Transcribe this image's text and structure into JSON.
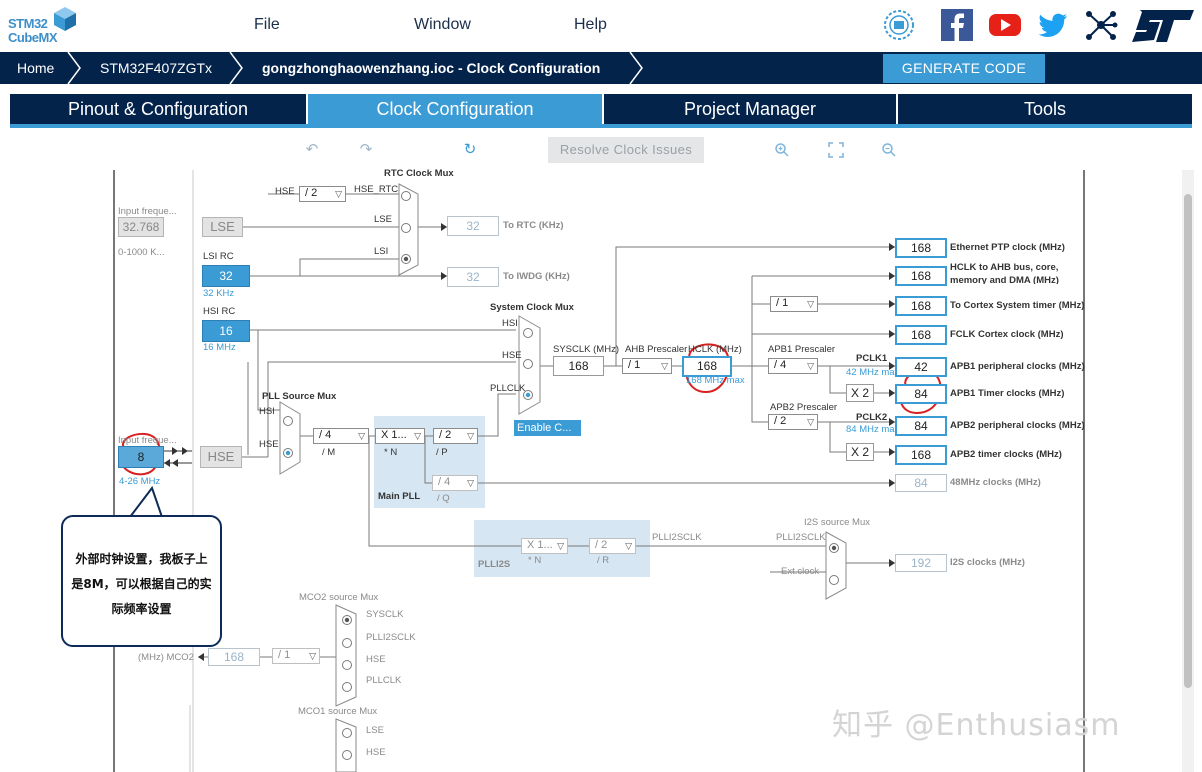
{
  "app": {
    "logo_line1": "STM32",
    "logo_line2": "CubeMX"
  },
  "menu": {
    "file": "File",
    "window": "Window",
    "help": "Help"
  },
  "social_icons": [
    "anniversary-badge-icon",
    "facebook-icon",
    "youtube-icon",
    "twitter-icon",
    "network-share-icon",
    "st-logo-icon"
  ],
  "breadcrumb": {
    "home": "Home",
    "device": "STM32F407ZGTx",
    "project": "gongzhonghaowenzhang.ioc - Clock Configuration"
  },
  "generate_label": "GENERATE CODE",
  "tabs": [
    "Pinout & Configuration",
    "Clock Configuration",
    "Project Manager",
    "Tools"
  ],
  "toolbar": {
    "resolve_label": "Resolve Clock Issues"
  },
  "colors": {
    "navy": "#03234b",
    "accent": "#3a9bd5",
    "annotation_red": "#d92020"
  },
  "diagram": {
    "lse_input_label": "Input freque...",
    "lse_input_value": "32.768",
    "lse_range": "0-1000 K...",
    "lse_label": "LSE",
    "lsi_rc_label": "LSI RC",
    "lsi_value": "32",
    "lsi_khz": "32 KHz",
    "hsi_rc_label": "HSI RC",
    "hsi_value": "16",
    "hsi_mhz": "16 MHz",
    "hse_input_label": "Input freque...",
    "hse_input_value": "8",
    "hse_range": "4-26 MHz",
    "hse_label": "HSE",
    "rtc_mux_title": "RTC Clock Mux",
    "rtc_mux_in_hse": "HSE",
    "rtc_div": "/ 2",
    "rtc_hse_rtc": "HSE_RTC",
    "rtc_lse": "LSE",
    "rtc_lsi": "LSI",
    "rtc_out_value": "32",
    "rtc_out_label": "To RTC (KHz)",
    "iwdg_out_value": "32",
    "iwdg_out_label": "To IWDG (KHz)",
    "sys_mux_title": "System Clock Mux",
    "sys_hsi": "HSI",
    "sys_hse": "HSE",
    "sys_pllclk": "PLLCLK",
    "enable_css": "Enable C...",
    "pll_src_title": "PLL Source Mux",
    "pll_src_hsi": "HSI",
    "pll_src_hse": "HSE",
    "pll_m": "/ 4",
    "pll_m_label": "/ M",
    "pll_n": "X 1...",
    "pll_n_label": "* N",
    "pll_p": "/ 2",
    "pll_p_label": "/ P",
    "pll_q": "/ 4",
    "pll_q_label": "/ Q",
    "main_pll_label": "Main PLL",
    "sysclk_label": "SYSCLK (MHz)",
    "sysclk_value": "168",
    "ahb_label": "AHB Prescaler",
    "ahb_value": "/ 1",
    "hclk_label": "HCLK (MHz)",
    "hclk_value": "168",
    "hclk_max": "168 MHz max",
    "apb1_label": "APB1 Prescaler",
    "apb1_value": "/ 4",
    "pclk1_label": "PCLK1",
    "pclk1_max": "42 MHz max",
    "apb1_timer_mult": "X 2",
    "apb2_label": "APB2 Prescaler",
    "apb2_value": "/ 2",
    "pclk2_label": "PCLK2",
    "pclk2_max": "84 MHz max",
    "apb2_timer_mult": "X 2",
    "cortex_div": "/ 1",
    "outputs": [
      {
        "value": "168",
        "label": "Ethernet PTP clock (MHz)"
      },
      {
        "value": "168",
        "label": "HCLK to AHB bus, core,"
      },
      {
        "value": "168",
        "label": "To Cortex System timer (MHz)"
      },
      {
        "value": "168",
        "label": "FCLK Cortex clock (MHz)"
      },
      {
        "value": "42",
        "label": "APB1 peripheral clocks (MHz)"
      },
      {
        "value": "84",
        "label": "APB1 Timer clocks (MHz)"
      },
      {
        "value": "84",
        "label": "APB2 peripheral clocks (MHz)"
      },
      {
        "value": "168",
        "label": "APB2 timer clocks (MHz)"
      }
    ],
    "hclk_out_line2": "memory and DMA (MHz)",
    "usb48_value": "84",
    "usb48_label": "48MHz clocks (MHz)",
    "plli2s_n": "X 1...",
    "plli2s_n_label": "* N",
    "plli2s_r": "/ 2",
    "plli2s_r_label": "/ R",
    "plli2s_label": "PLLI2S",
    "plli2sclk_label": "PLLI2SCLK",
    "i2s_mux_title": "I2S source Mux",
    "i2s_in_plli2sclk": "PLLI2SCLK",
    "i2s_in_ext": "Ext.clock",
    "i2s_value": "192",
    "i2s_label": "I2S clocks (MHz)",
    "mco2_title": "MCO2 source Mux",
    "mco2_sysclk": "SYSCLK",
    "mco2_plli2sclk": "PLLI2SCLK",
    "mco2_hse": "HSE",
    "mco2_pllclk": "PLLCLK",
    "mco2_div": "/ 1",
    "mco2_value": "168",
    "mco2_out_label": "(MHz) MCO2",
    "mco1_title": "MCO1 source Mux",
    "mco1_lse": "LSE",
    "mco1_hse": "HSE"
  },
  "callout_text": [
    "外部时钟设置，我板子上",
    "是8M，可以根据自己的实",
    "际频率设置"
  ],
  "watermark": "知乎 @Enthusiasm"
}
